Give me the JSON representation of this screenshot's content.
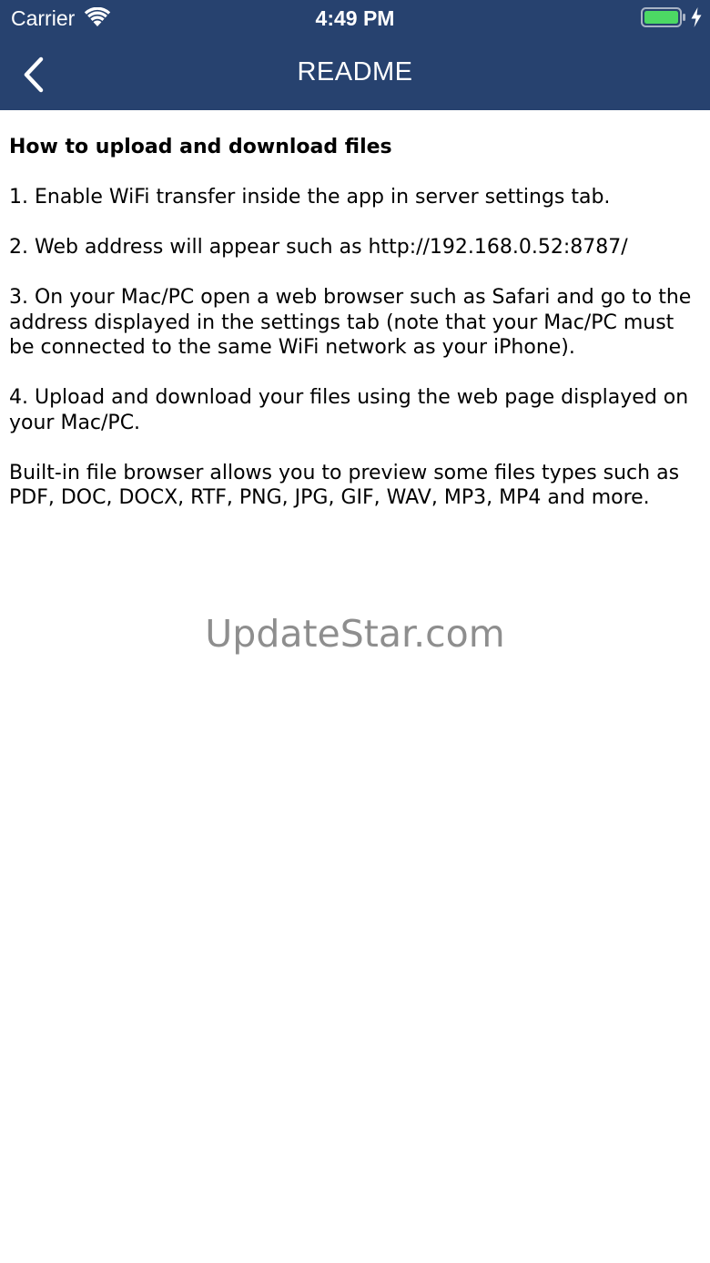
{
  "status_bar": {
    "carrier": "Carrier",
    "time": "4:49 PM"
  },
  "nav": {
    "title": "README",
    "back_icon": "chevron-left-icon"
  },
  "content": {
    "heading": "How to upload and download files",
    "paragraphs": [
      "1. Enable WiFi transfer inside the app in server settings tab.",
      "2. Web address will appear such as http://192.168.0.52:8787/",
      "3. On your Mac/PC open a web browser such as Safari and go to the address displayed in the settings tab (note that your Mac/PC must be connected to the same WiFi network as your iPhone).",
      "4. Upload and download your files using the web page displayed on your Mac/PC.",
      "Built-in file browser allows you to preview some files types such as PDF, DOC, DOCX, RTF, PNG, JPG, GIF, WAV, MP3, MP4 and more."
    ]
  },
  "watermark": "UpdateStar.com",
  "colors": {
    "header_background": "#27426f",
    "battery_fill": "#4cd964",
    "watermark": "#8e8e8e"
  }
}
